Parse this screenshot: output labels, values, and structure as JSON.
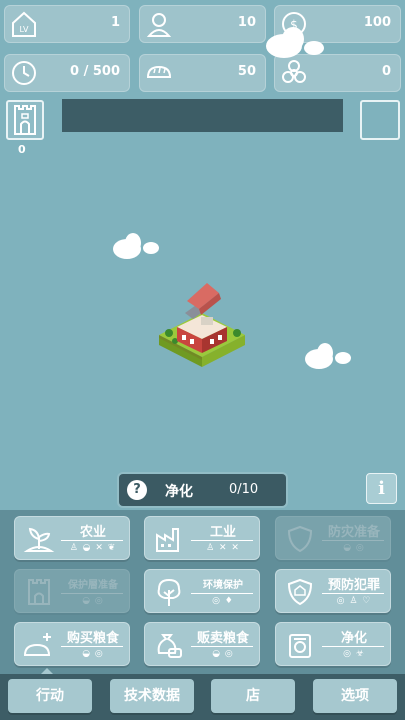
{
  "stats": {
    "level": {
      "icon": "level-house-icon",
      "icon_text": "LV",
      "value": "1"
    },
    "population": {
      "icon": "person-icon",
      "value": "10"
    },
    "money": {
      "icon": "money-bag-icon",
      "value": "100"
    },
    "time": {
      "icon": "clock-icon",
      "value": "0 / 500"
    },
    "food": {
      "icon": "bread-icon",
      "value": "50"
    },
    "pollution": {
      "icon": "biohazard-icon",
      "value": "0"
    }
  },
  "castle": {
    "icon": "castle-icon",
    "count": "0"
  },
  "purify_banner": {
    "help": "?",
    "label": "净化",
    "progress": "0/10"
  },
  "info_button": "i",
  "actions": {
    "agriculture": {
      "label": "农业",
      "subs": "♙ ◒ ✕ ❦",
      "enabled": true
    },
    "industry": {
      "label": "工业",
      "subs": "♙ ✕ ✕",
      "enabled": true
    },
    "disaster_prep": {
      "label": "防灾准备",
      "subs": "◒ ◎",
      "enabled": false
    },
    "protect_prep": {
      "label": "保护層准备",
      "subs": "◒ ◎",
      "enabled": false
    },
    "environment": {
      "label": "环境保护",
      "subs": "◎ ♦",
      "enabled": true
    },
    "crime_prevention": {
      "label": "预防犯罪",
      "subs": "◎ ♙ ♡",
      "enabled": true
    },
    "buy_food": {
      "label": "购买粮食",
      "subs": "◒ ◎",
      "enabled": true
    },
    "sell_food": {
      "label": "贩卖粮食",
      "subs": "◒ ◎",
      "enabled": true
    },
    "purify": {
      "label": "净化",
      "subs": "◎ ☣",
      "enabled": true
    }
  },
  "tabs": [
    "行动",
    "技术数据",
    "店",
    "选项"
  ],
  "colors": {
    "background": "#7fb2bd",
    "panel": "#618e99",
    "button": "#a6c8cf",
    "dark": "#3d5d66"
  }
}
